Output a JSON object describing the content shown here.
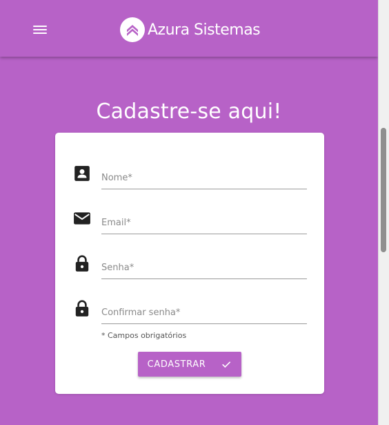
{
  "header": {
    "brand_name": "Azura Sistemas",
    "menu_icon": "hamburger-menu-icon",
    "logo_icon": "chevron-up-logo-icon"
  },
  "page": {
    "title": "Cadastre-se aqui!"
  },
  "form": {
    "fields": [
      {
        "placeholder": "Nome*",
        "value": "",
        "icon": "contact-card-icon"
      },
      {
        "placeholder": "Email*",
        "value": "",
        "icon": "email-icon"
      },
      {
        "placeholder": "Senha*",
        "value": "",
        "icon": "lock-icon"
      },
      {
        "placeholder": "Confirmar senha*",
        "value": "",
        "icon": "lock-icon"
      }
    ],
    "required_note": "* Campos obrigatórios",
    "submit_label": "CADASTRAR",
    "submit_icon": "check-icon"
  },
  "colors": {
    "brand": "#b762c7",
    "card": "#ffffff",
    "icon": "#222222"
  }
}
